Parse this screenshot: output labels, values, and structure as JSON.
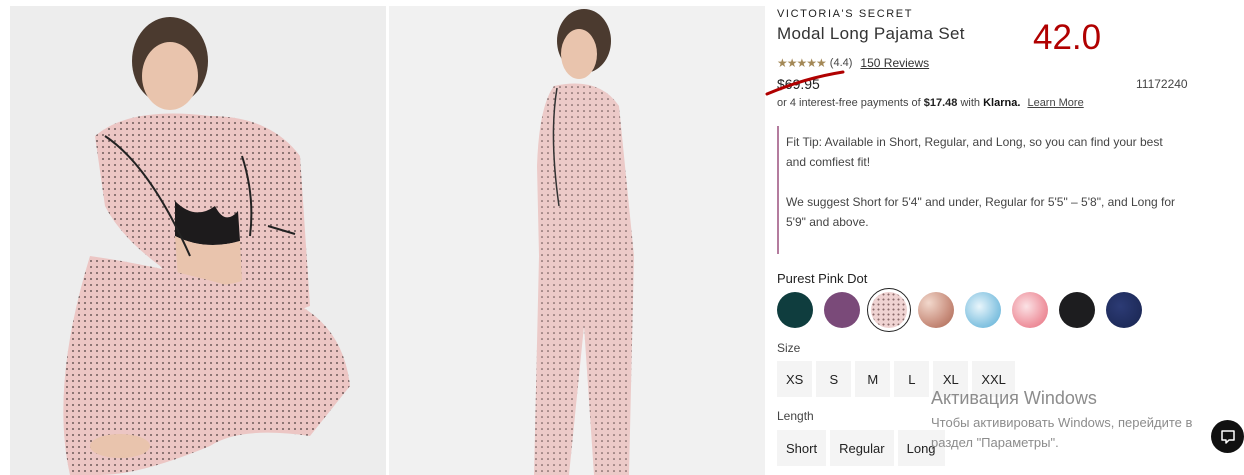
{
  "images": [
    {
      "alt": "Model sitting in pink pajamas"
    },
    {
      "alt": "Model standing in pink pajamas"
    }
  ],
  "product": {
    "brand": "VICTORIA'S SECRET",
    "title": "Modal Long Pajama Set",
    "annotation": "42.0",
    "rating_stars": "★★★★★",
    "rating_value": "(4.4)",
    "reviews_label": "150 Reviews",
    "price": "$69.95",
    "sku": "11172240",
    "klarna_prefix": "or 4 interest-free payments of",
    "klarna_amount": "$17.48",
    "klarna_with": "with",
    "klarna_brand": "Klarna.",
    "learn_more": "Learn More"
  },
  "fit_tip": {
    "line1": "Fit Tip: Available in Short, Regular, and Long, so you can find your best and comfiest fit!",
    "line2": "We suggest Short for 5'4\" and under, Regular for 5'5\" – 5'8\", and Long for 5'9\" and above."
  },
  "color": {
    "selected_name": "Purest Pink Dot",
    "swatches": [
      {
        "name": "dark-teal",
        "color": "#0f3d3e"
      },
      {
        "name": "plum",
        "color": "#7a4a79"
      },
      {
        "name": "pink-dot",
        "color": "#efd3d2"
      },
      {
        "name": "rust-print",
        "color": "#c98f7e"
      },
      {
        "name": "sky-tie-dye",
        "color": "#8cc7e3"
      },
      {
        "name": "pink-tie-dye",
        "color": "#ef97a2"
      },
      {
        "name": "black",
        "color": "#1d1d1f"
      },
      {
        "name": "navy",
        "color": "#1e2b5a"
      }
    ]
  },
  "size": {
    "label": "Size",
    "options": [
      "XS",
      "S",
      "M",
      "L",
      "XL",
      "XXL"
    ]
  },
  "length": {
    "label": "Length",
    "options": [
      "Short",
      "Regular",
      "Long"
    ]
  },
  "watermark": {
    "title": "Активация Windows",
    "sub": "Чтобы активировать Windows, перейдите в раздел \"Параметры\"."
  },
  "colors": {
    "accent_border": "#b47c9e",
    "annotation": "#b00000",
    "stars": "#a48957"
  }
}
